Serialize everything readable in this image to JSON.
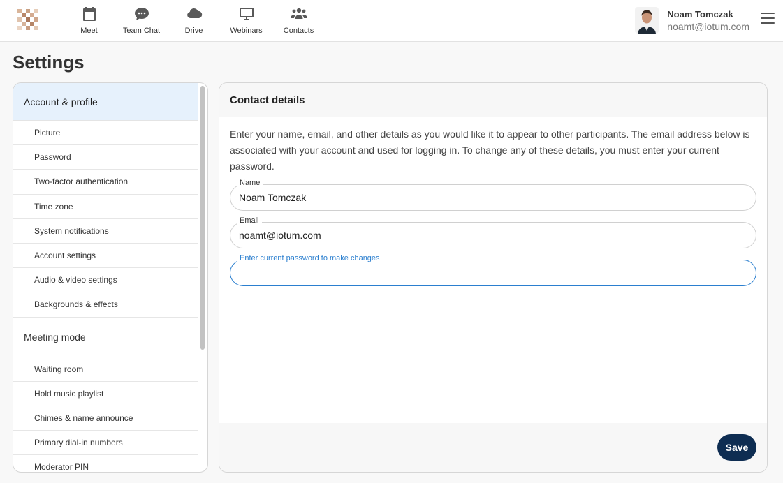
{
  "nav": {
    "items": [
      {
        "label": "Meet",
        "icon": "calendar-icon"
      },
      {
        "label": "Team Chat",
        "icon": "chat-icon"
      },
      {
        "label": "Drive",
        "icon": "cloud-icon"
      },
      {
        "label": "Webinars",
        "icon": "monitor-icon"
      },
      {
        "label": "Contacts",
        "icon": "contacts-icon"
      }
    ]
  },
  "user": {
    "name": "Noam Tomczak",
    "email": "noamt@iotum.com"
  },
  "page": {
    "title": "Settings"
  },
  "sidebar": {
    "section1": "Account & profile",
    "items1": [
      "Picture",
      "Password",
      "Two-factor authentication",
      "Time zone",
      "System notifications",
      "Account settings",
      "Audio & video settings",
      "Backgrounds & effects"
    ],
    "section2": "Meeting mode",
    "items2": [
      "Waiting room",
      "Hold music playlist",
      "Chimes & name announce",
      "Primary dial-in numbers",
      "Moderator PIN"
    ]
  },
  "contact": {
    "title": "Contact details",
    "description": "Enter your name, email, and other details as you would like it to appear to other participants. The email address below is associated with your account and used for logging in. To change any of these details, you must enter your current password.",
    "name_label": "Name",
    "name_value": "Noam Tomczak",
    "email_label": "Email",
    "email_value": "noamt@iotum.com",
    "password_label": "Enter current password to make changes",
    "password_value": "",
    "save_label": "Save"
  },
  "colors": {
    "accent": "#2b7fcf",
    "button": "#0e2d52",
    "active_item": "#e6f1fc"
  }
}
